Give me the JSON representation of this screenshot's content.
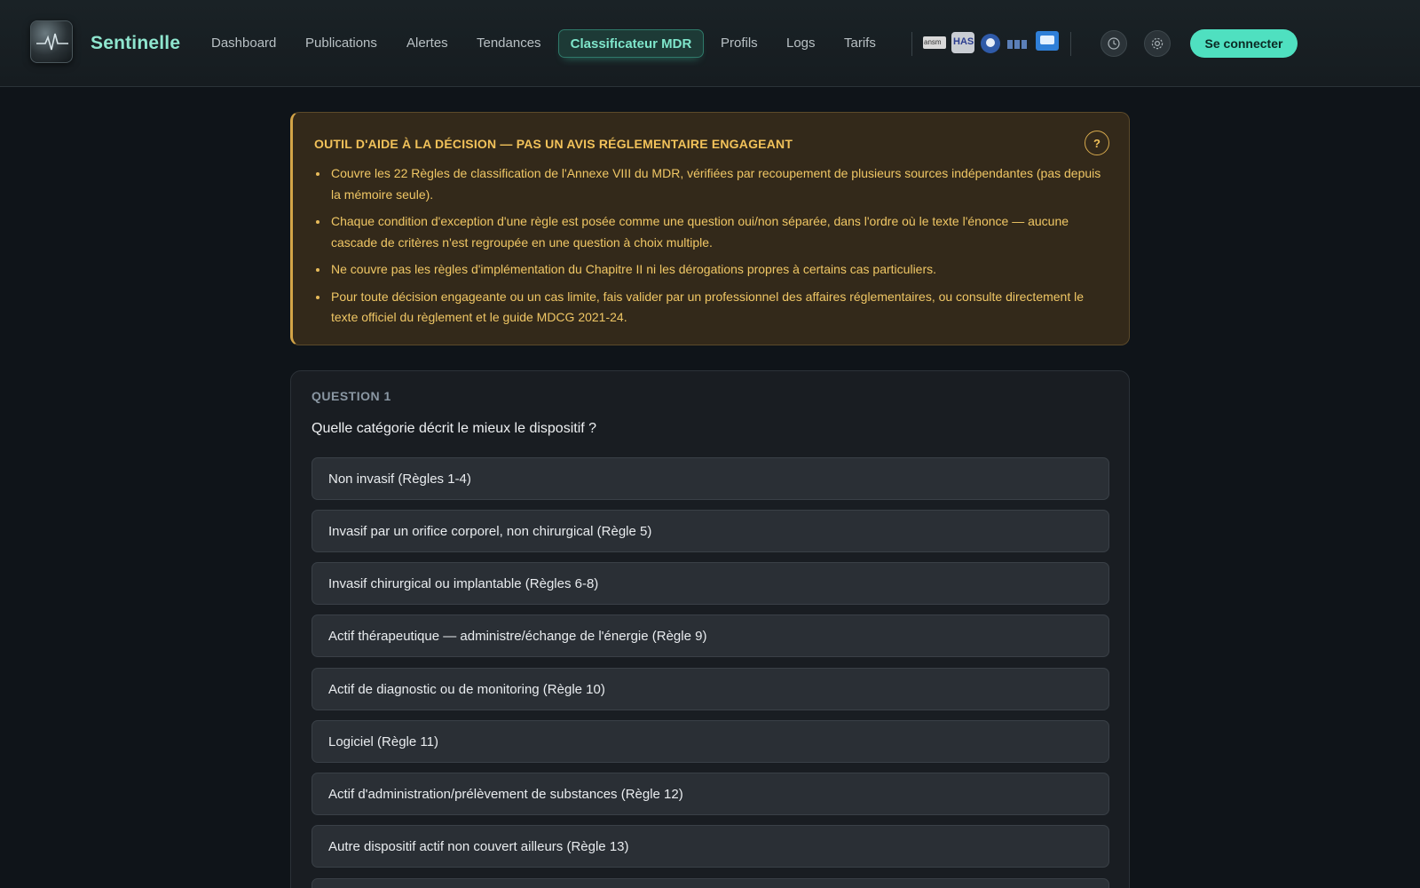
{
  "header": {
    "brand": "Sentinelle",
    "nav": [
      "Dashboard",
      "Publications",
      "Alertes",
      "Tendances",
      "Classificateur MDR",
      "Profils",
      "Logs",
      "Tarifs"
    ],
    "active_nav": "Classificateur MDR",
    "partners": [
      "ansm-logo",
      "has-logo",
      "seal-logo",
      "flag-logo",
      "chat-logo"
    ],
    "partner_text": {
      "ansm": "ansm",
      "has": "HAS"
    },
    "icons": [
      "clock-icon",
      "gear-icon"
    ],
    "connect_label": "Se connecter",
    "accent": "#4fe0c0"
  },
  "warning": {
    "title": "OUTIL D'AIDE À LA DÉCISION — PAS UN AVIS RÉGLEMENTAIRE ENGAGEANT",
    "help": "?",
    "items": [
      "Couvre les 22 Règles de classification de l'Annexe VIII du MDR, vérifiées par recoupement de plusieurs sources indépendantes (pas depuis la mémoire seule).",
      "Chaque condition d'exception d'une règle est posée comme une question oui/non séparée, dans l'ordre où le texte l'énonce — aucune cascade de critères n'est regroupée en une question à choix multiple.",
      "Ne couvre pas les règles d'implémentation du Chapitre II ni les dérogations propres à certains cas particuliers.",
      "Pour toute décision engageante ou un cas limite, fais valider par un professionnel des affaires réglementaires, ou consulte directement le texte officiel du règlement et le guide MDCG 2021-24."
    ],
    "color": "#f2c25a"
  },
  "question": {
    "label": "QUESTION 1",
    "text": "Quelle catégorie décrit le mieux le dispositif ?",
    "options": [
      "Non invasif (Règles 1-4)",
      "Invasif par un orifice corporel, non chirurgical (Règle 5)",
      "Invasif chirurgical ou implantable (Règles 6-8)",
      "Actif thérapeutique — administre/échange de l'énergie (Règle 9)",
      "Actif de diagnostic ou de monitoring (Règle 10)",
      "Logiciel (Règle 11)",
      "Actif d'administration/prélèvement de substances (Règle 12)",
      "Autre dispositif actif non couvert ailleurs (Règle 13)",
      ""
    ]
  }
}
